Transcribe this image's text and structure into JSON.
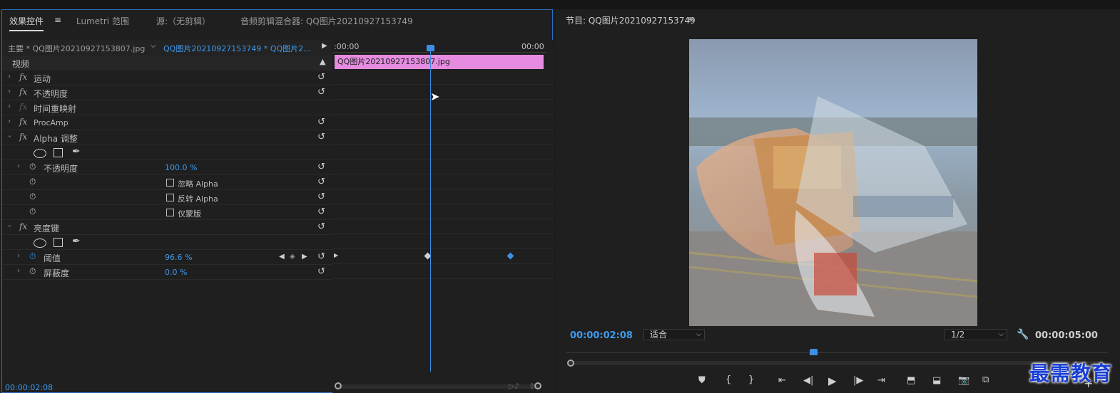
{
  "left_tabs": {
    "effect_controls": "效果控件",
    "menu_icon": "≡",
    "lumetri": "Lumetri 范围",
    "source": "源:（无剪辑）",
    "audio_mixer": "音频剪辑混合器: QQ图片20210927153749"
  },
  "clip_bar": {
    "master": "主要 * QQ图片20210927153807.jpg",
    "sequence": "QQ图片20210927153749 * QQ图片2..."
  },
  "timeline": {
    "start_time": ":00:00",
    "end_time": "00:00",
    "clip_label": "QQ图片20210927153807.jpg"
  },
  "effects": {
    "video_header": "视频",
    "motion": "运动",
    "opacity": "不透明度",
    "time_remap": "时间重映射",
    "procamp": "ProcAmp",
    "alpha_adjust": "Alpha 调整",
    "alpha_opacity_label": "不透明度",
    "alpha_opacity_value": "100.0 %",
    "ignore_alpha": "忽略 Alpha",
    "invert_alpha": "反转 Alpha",
    "mask_only": "仅蒙版",
    "luma_key": "亮度键",
    "threshold_label": "阈值",
    "threshold_value": "96.6 %",
    "cutoff_label": "屏蔽度",
    "cutoff_value": "0.0 %"
  },
  "left_footer_time": "00:00:02:08",
  "program": {
    "title": "节目: QQ图片20210927153749",
    "menu_icon": "≡",
    "current_time": "00:00:02:08",
    "zoom": "适合",
    "resolution": "1/2",
    "duration": "00:00:05:00"
  },
  "watermark": "最需教育",
  "colors": {
    "accent": "#3d9bf0",
    "clip": "#e58be0",
    "panel_border": "#2d6fc1"
  }
}
